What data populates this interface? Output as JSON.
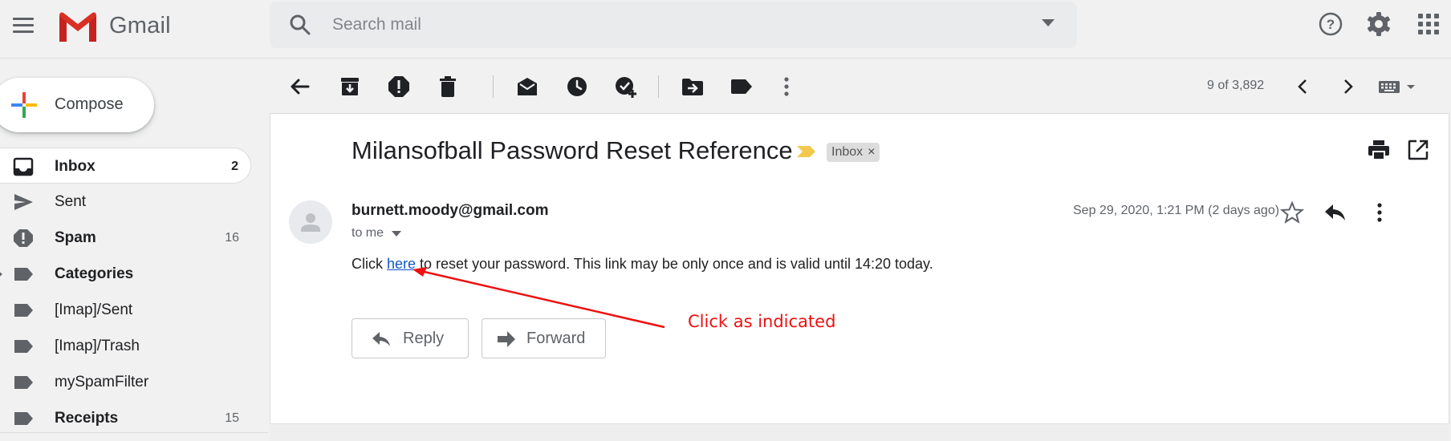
{
  "header": {
    "app_name": "Gmail",
    "search_placeholder": "Search mail",
    "icons": [
      "menu-icon",
      "gmail-logo",
      "search-icon",
      "search-options-icon",
      "help-icon",
      "settings-gear-icon",
      "apps-grid-icon"
    ]
  },
  "compose": {
    "label": "Compose"
  },
  "sidebar": {
    "items": [
      {
        "label": "Inbox",
        "count": "2",
        "icon": "inbox-icon",
        "bold": true,
        "active": true
      },
      {
        "label": "Sent",
        "count": "",
        "icon": "send-icon",
        "bold": false
      },
      {
        "label": "Spam",
        "count": "16",
        "icon": "spam-icon",
        "bold": true
      },
      {
        "label": "Categories",
        "count": "",
        "icon": "label-icon",
        "bold": true
      },
      {
        "label": "[Imap]/Sent",
        "count": "",
        "icon": "label-icon",
        "bold": false
      },
      {
        "label": "[Imap]/Trash",
        "count": "",
        "icon": "label-icon",
        "bold": false
      },
      {
        "label": "mySpamFilter",
        "count": "",
        "icon": "label-icon",
        "bold": false
      },
      {
        "label": "Receipts",
        "count": "15",
        "icon": "label-icon",
        "bold": true
      }
    ]
  },
  "toolbar": {
    "pager": "9 of 3,892",
    "icons": [
      "back-arrow-icon",
      "archive-icon",
      "report-spam-icon",
      "delete-icon",
      "mark-unread-icon",
      "snooze-icon",
      "add-task-icon",
      "move-to-icon",
      "labels-icon",
      "more-vert-icon",
      "newer-chevron-icon",
      "older-chevron-icon",
      "keyboard-icon"
    ]
  },
  "message": {
    "subject": "Milansofball Password Reset Reference",
    "label_chip": "Inbox",
    "chip_close": "×",
    "sender": "burnett.moody@gmail.com",
    "to": "to me",
    "date": "Sep 29, 2020, 1:21 PM (2 days ago)",
    "body_before": "Click ",
    "body_link": "here",
    "body_after": " to reset your password. This link may be only once and is valid until 14:20 today.",
    "reply_label": "Reply",
    "forward_label": "Forward"
  },
  "annotation": {
    "text": "Click as indicated",
    "color": "#ee1111"
  },
  "colors": {
    "background": "#f1f1f1",
    "link": "#1155cc",
    "important_marker": "#f2c94c",
    "chip": "#dddddd"
  }
}
